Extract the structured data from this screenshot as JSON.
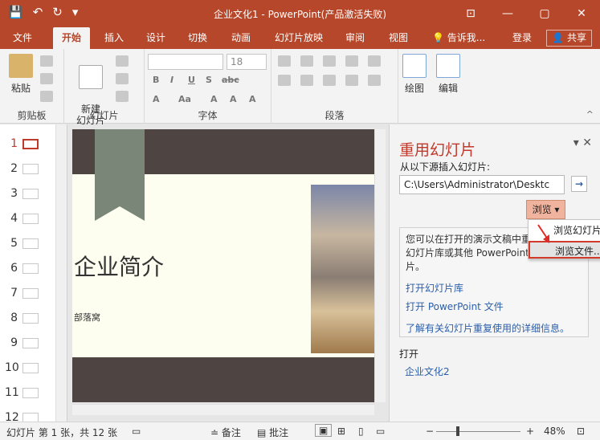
{
  "window": {
    "title": "企业文化1 - PowerPoint(产品激活失败)",
    "minimize": "—",
    "restore": "▢",
    "close": "✕",
    "ribbon_display": "⊡"
  },
  "qat": {
    "save": "💾",
    "undo": "↶",
    "redo": "↻",
    "customize": "▾"
  },
  "tabs": [
    "文件",
    "开始",
    "插入",
    "设计",
    "切换",
    "动画",
    "幻灯片放映",
    "审阅",
    "视图",
    "告诉我..."
  ],
  "account": {
    "login": "登录",
    "share": "共享"
  },
  "ribbon": {
    "paste": "粘贴",
    "new_slide": "新建\n幻灯片",
    "font_size": "18",
    "drawing": "绘图",
    "editing": "编辑",
    "groups": [
      "剪贴板",
      "幻灯片",
      "字体",
      "段落"
    ]
  },
  "thumbnails": [
    "1",
    "2",
    "3",
    "4",
    "5",
    "6",
    "7",
    "8",
    "9",
    "10",
    "11",
    "12"
  ],
  "slide": {
    "title": "企业简介",
    "subtitle": "部落窝"
  },
  "task_pane": {
    "title": "重用幻灯片",
    "source_label": "从以下源插入幻灯片:",
    "path": "C:\\Users\\Administrator\\Desktc",
    "go": "→",
    "browse": "浏览",
    "dropdown": [
      "浏览幻灯片",
      "浏览文件..."
    ],
    "info_text": "您可以在打开的演示文稿中重\n幻灯片库或其他 PowerPoint\n片。",
    "links": [
      "打开幻灯片库",
      "打开 PowerPoint 文件",
      "了解有关幻灯片重复使用的详细信息。"
    ],
    "open_label": "打开",
    "open_item": "企业文化2"
  },
  "status": {
    "slide_info": "幻灯片 第 1 张，共 12 张",
    "notes": "备注",
    "comments": "批注",
    "zoom": "48%"
  },
  "colors": {
    "accent": "#b7472a",
    "link": "#2b5ea8",
    "title_red": "#c0392b"
  }
}
